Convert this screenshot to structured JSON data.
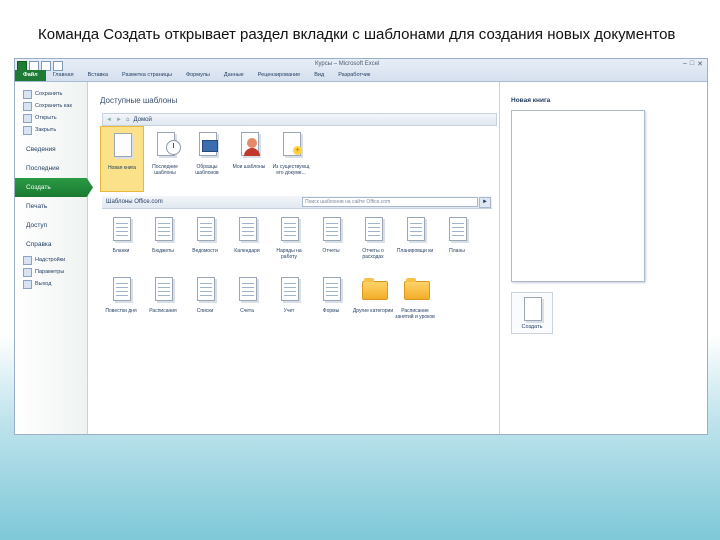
{
  "slide": {
    "caption": "Команда Создать открывает раздел вкладки с шаблонами для создания новых документов"
  },
  "window": {
    "title": "Курсы – Microsoft Excel",
    "controls": [
      "–",
      "□",
      "✕"
    ],
    "accent": "#1f7a35"
  },
  "ribbon": {
    "tabs": [
      "Файл",
      "Главная",
      "Вставка",
      "Разметка страницы",
      "Формулы",
      "Данные",
      "Рецензирование",
      "Вид",
      "Разработчик"
    ]
  },
  "backstage": {
    "commands": [
      {
        "label": "Сохранить",
        "icon": "save-icon"
      },
      {
        "label": "Сохранить как",
        "icon": "save-as-icon"
      },
      {
        "label": "Открыть",
        "icon": "open-folder-icon"
      },
      {
        "label": "Закрыть",
        "icon": "close-file-icon"
      }
    ],
    "categories": [
      "Сведения",
      "Последние",
      "Создать",
      "Печать",
      "Доступ",
      "Справка"
    ],
    "active_category": "Создать",
    "bottom_commands": [
      {
        "label": "Надстройки",
        "icon": "addins-icon"
      },
      {
        "label": "Параметры",
        "icon": "options-icon"
      },
      {
        "label": "Выход",
        "icon": "exit-icon"
      }
    ]
  },
  "templates": {
    "heading": "Доступные шаблоны",
    "nav_location": "Домой",
    "nav_back": "◄",
    "nav_forward": "►",
    "home_icon": "home-icon",
    "available": [
      {
        "label": "Новая книга",
        "icon": "blank-workbook-icon",
        "selected": true
      },
      {
        "label": "Последние шаблоны",
        "icon": "recent-templates-icon"
      },
      {
        "label": "Образцы шаблонов",
        "icon": "sample-templates-icon"
      },
      {
        "label": "Мои шаблоны",
        "icon": "my-templates-icon"
      },
      {
        "label": "Из существующ его докуме...",
        "icon": "from-existing-icon"
      }
    ],
    "office_heading": "Шаблоны Office.com",
    "search_placeholder": "Поиск шаблонов на сайте Office.com",
    "search_button": "►",
    "office": [
      {
        "label": "Бланки",
        "icon": "forms-icon",
        "kind": "doc"
      },
      {
        "label": "Бюджеты",
        "icon": "budgets-icon",
        "kind": "doc"
      },
      {
        "label": "Ведомости",
        "icon": "statements-icon",
        "kind": "doc"
      },
      {
        "label": "Календари",
        "icon": "calendars-icon",
        "kind": "doc"
      },
      {
        "label": "Наряды на работу",
        "icon": "work-orders-icon",
        "kind": "doc"
      },
      {
        "label": "Отчеты",
        "icon": "reports-icon",
        "kind": "doc"
      },
      {
        "label": "Отчеты о расходах",
        "icon": "expense-reports-icon",
        "kind": "doc"
      },
      {
        "label": "Планировщи ки",
        "icon": "planners-icon",
        "kind": "doc"
      },
      {
        "label": "Планы",
        "icon": "plans-icon",
        "kind": "doc"
      },
      {
        "label": "Повестки дня",
        "icon": "agendas-icon",
        "kind": "doc"
      },
      {
        "label": "Расписания",
        "icon": "schedules-icon",
        "kind": "doc"
      },
      {
        "label": "Списки",
        "icon": "lists-icon",
        "kind": "doc"
      },
      {
        "label": "Счета",
        "icon": "invoices-icon",
        "kind": "doc"
      },
      {
        "label": "Учет",
        "icon": "accounting-icon",
        "kind": "doc"
      },
      {
        "label": "Формы",
        "icon": "forms-sheet-icon",
        "kind": "doc"
      },
      {
        "label": "Другие категории",
        "icon": "folder-icon",
        "kind": "folder"
      },
      {
        "label": "Расписание занятий и уроков",
        "icon": "folder-icon",
        "kind": "folder"
      }
    ]
  },
  "preview": {
    "title": "Новая книга",
    "create_label": "Создать",
    "create_icon": "new-document-icon"
  }
}
